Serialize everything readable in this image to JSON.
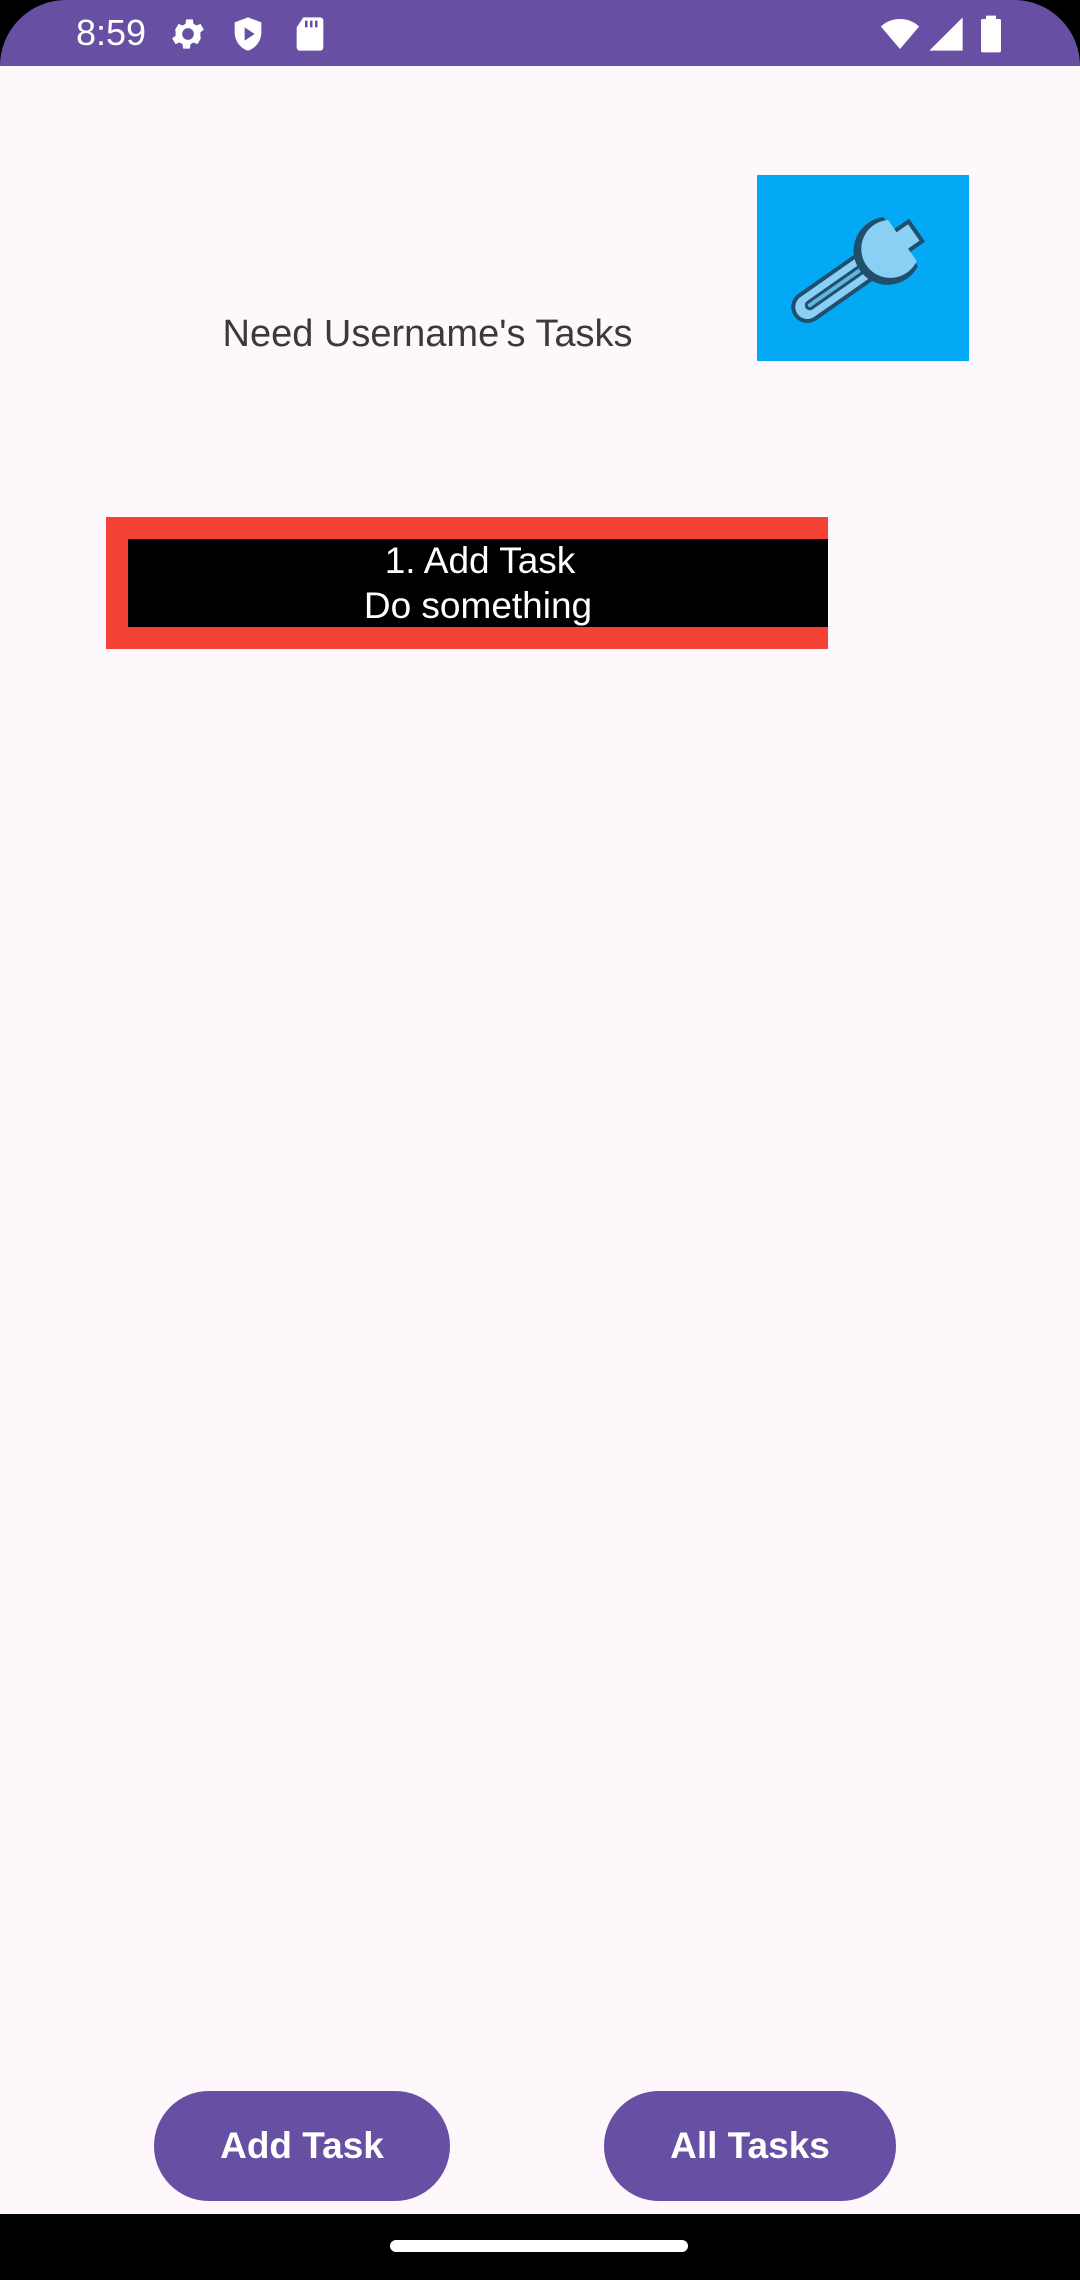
{
  "status_bar": {
    "time": "8:59",
    "color": "#6750a4",
    "left_icons": [
      "settings-icon",
      "shield-icon",
      "sd-card-icon"
    ],
    "right_icons": [
      "wifi-icon",
      "signal-icon",
      "battery-icon"
    ]
  },
  "app": {
    "background": "#fef7fb",
    "title": "Need Username's Tasks",
    "settings_button": {
      "icon": "wrench-icon",
      "background": "#03a9f4"
    }
  },
  "tasks": [
    {
      "title": "1. Add Task",
      "description": "Do something",
      "border_color": "#f44336",
      "background": "#000000"
    }
  ],
  "buttons": {
    "add_task": "Add Task",
    "all_tasks": "All Tasks",
    "color": "#6750a4"
  }
}
